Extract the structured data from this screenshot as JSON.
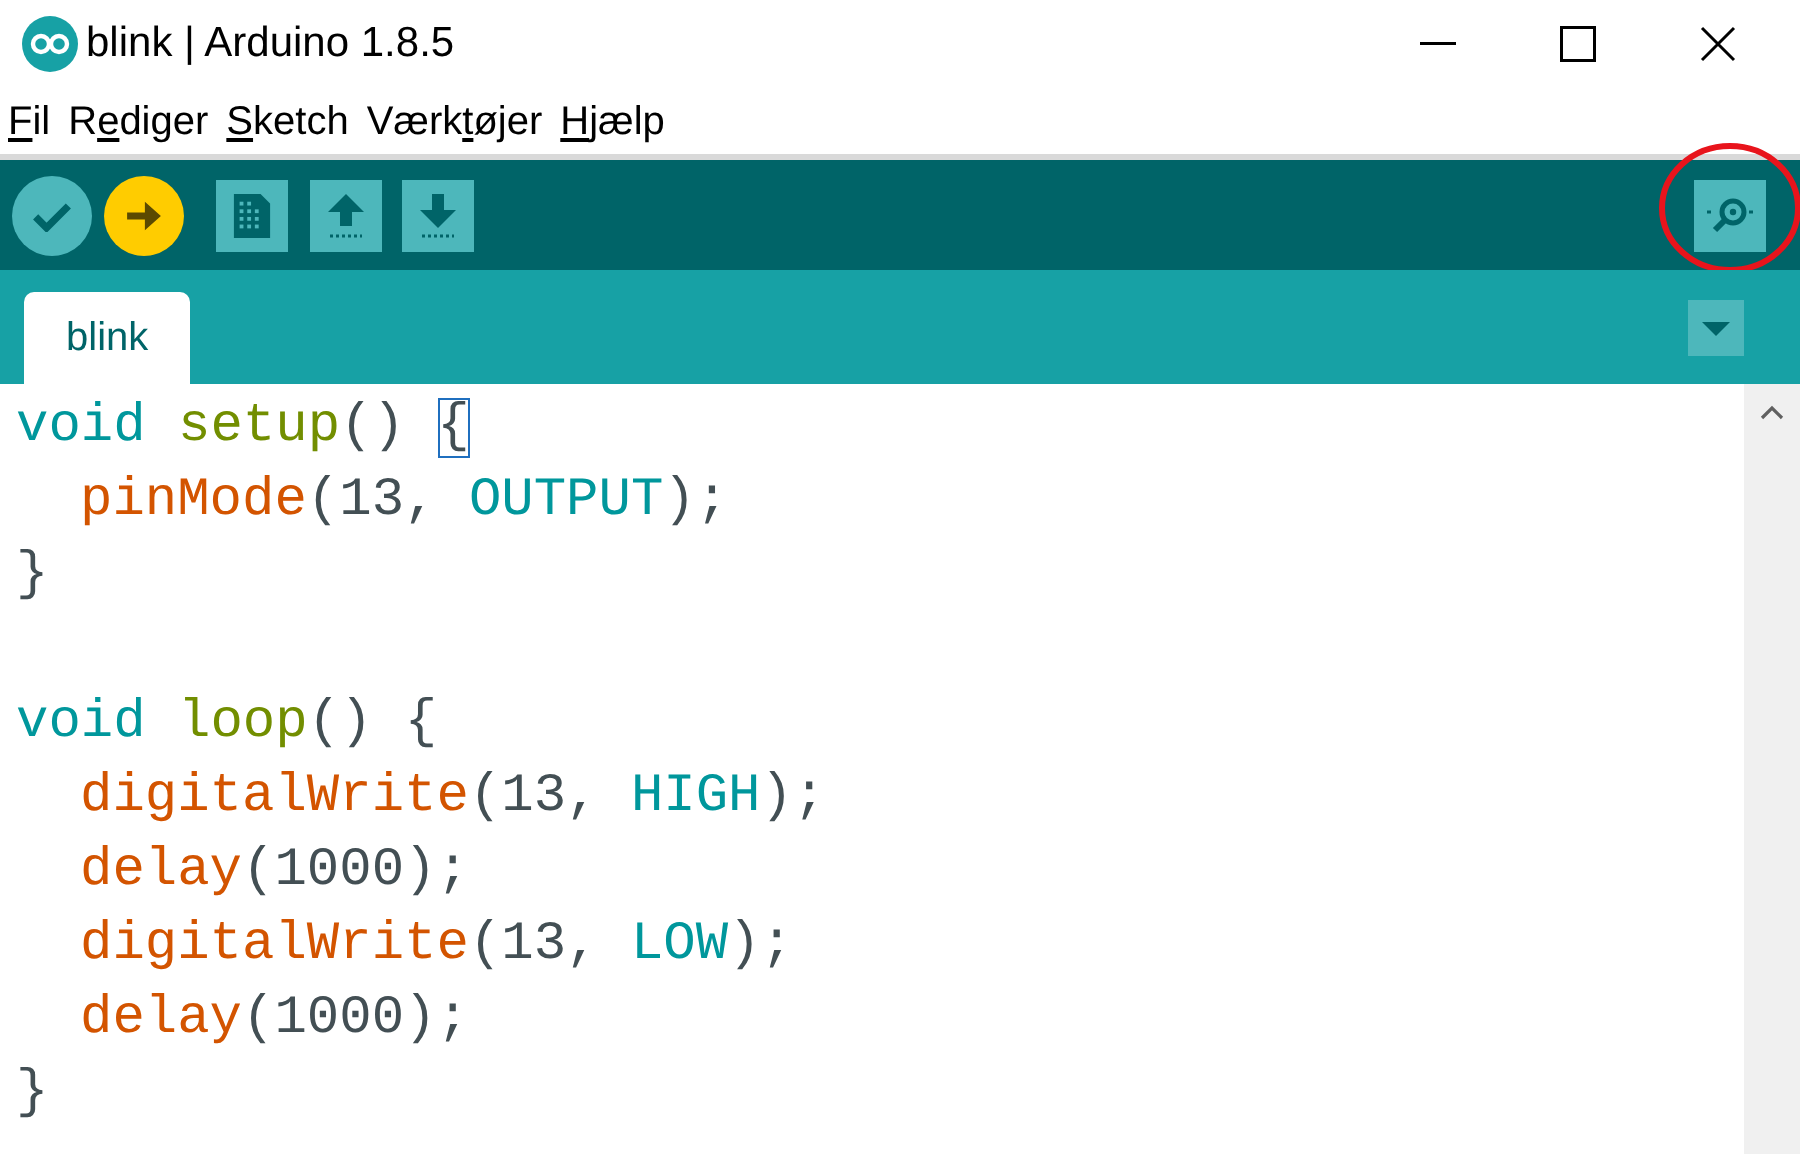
{
  "window": {
    "title": "blink | Arduino 1.8.5"
  },
  "menu": [
    {
      "key": "F",
      "after": "il"
    },
    {
      "before": "R",
      "key": "e",
      "after": "diger"
    },
    {
      "key": "S",
      "after": "ketch"
    },
    {
      "before": "Værk",
      "key": "t",
      "after": "øjer"
    },
    {
      "key": "H",
      "after": "jælp"
    }
  ],
  "toolbar": [
    {
      "kind": "verify"
    },
    {
      "kind": "upload"
    },
    {
      "kind": "new"
    },
    {
      "kind": "open"
    },
    {
      "kind": "save"
    },
    {
      "kind": "serial-monitor",
      "circled": true
    }
  ],
  "tabs": [
    {
      "label": "blink",
      "selected": true
    }
  ],
  "editor": {
    "lines": [
      {
        "indented": false,
        "gap_before": false,
        "tokens": [
          {
            "kind": "keyword",
            "text": "void "
          },
          {
            "kind": "structure",
            "text": "setup"
          },
          {
            "kind": "plain",
            "text": "() "
          },
          {
            "kind": "bracket",
            "text": "{"
          }
        ]
      },
      {
        "indented": true,
        "gap_before": false,
        "tokens": [
          {
            "kind": "function",
            "text": "pinMode"
          },
          {
            "kind": "plain",
            "text": "(13, "
          },
          {
            "kind": "constant",
            "text": "OUTPUT"
          },
          {
            "kind": "plain",
            "text": ");"
          }
        ]
      },
      {
        "indented": false,
        "gap_before": false,
        "tokens": [
          {
            "kind": "plain",
            "text": "}"
          }
        ]
      },
      {
        "indented": false,
        "gap_before": true,
        "tokens": [
          {
            "kind": "keyword",
            "text": "void "
          },
          {
            "kind": "structure",
            "text": "loop"
          },
          {
            "kind": "plain",
            "text": "() {"
          }
        ]
      },
      {
        "indented": true,
        "gap_before": false,
        "tokens": [
          {
            "kind": "function",
            "text": "digitalWrite"
          },
          {
            "kind": "plain",
            "text": "(13, "
          },
          {
            "kind": "constant",
            "text": "HIGH"
          },
          {
            "kind": "plain",
            "text": ");"
          }
        ]
      },
      {
        "indented": true,
        "gap_before": false,
        "tokens": [
          {
            "kind": "function",
            "text": "delay"
          },
          {
            "kind": "plain",
            "text": "(1000);"
          }
        ]
      },
      {
        "indented": true,
        "gap_before": false,
        "tokens": [
          {
            "kind": "function",
            "text": "digitalWrite"
          },
          {
            "kind": "plain",
            "text": "(13, "
          },
          {
            "kind": "constant",
            "text": "LOW"
          },
          {
            "kind": "plain",
            "text": ");"
          }
        ]
      },
      {
        "indented": true,
        "gap_before": false,
        "tokens": [
          {
            "kind": "function",
            "text": "delay"
          },
          {
            "kind": "plain",
            "text": "(1000);"
          }
        ]
      },
      {
        "indented": false,
        "gap_before": false,
        "tokens": [
          {
            "kind": "plain",
            "text": "}"
          }
        ]
      }
    ]
  }
}
